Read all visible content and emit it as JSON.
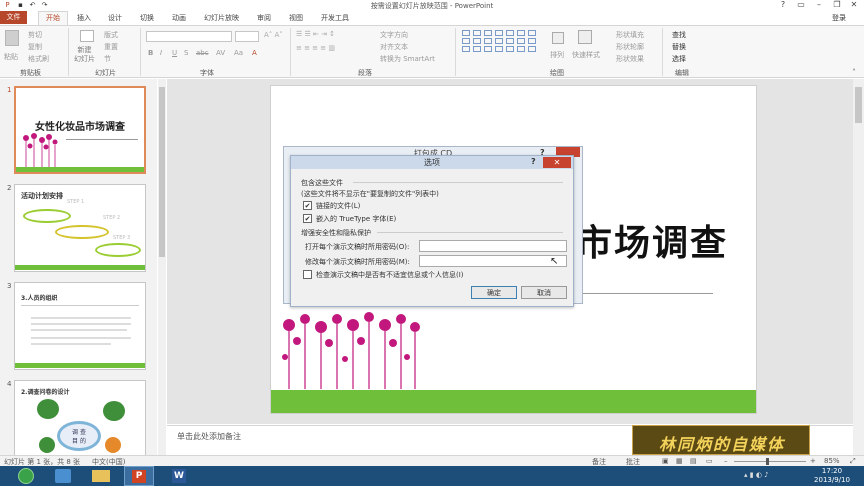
{
  "window": {
    "title": "按需设置幻灯片放映范围 - PowerPoint"
  },
  "tabs": {
    "file": "文件",
    "home": "开始",
    "insert": "插入",
    "design": "设计",
    "transitions": "切换",
    "animations": "动画",
    "slideshow": "幻灯片放映",
    "review": "审阅",
    "view": "视图",
    "developer": "开发工具",
    "login": "登录"
  },
  "ribbon": {
    "clipboard": {
      "paste": "粘贴",
      "cut": "剪切",
      "copy": "复制",
      "format_painter": "格式刷",
      "label": "剪贴板"
    },
    "slides": {
      "new_slide": "新建\n幻灯片",
      "layout": "版式",
      "reset": "重置",
      "section": "节",
      "label": "幻灯片"
    },
    "font": {
      "label": "字体",
      "bold": "B",
      "italic": "I",
      "underline": "U",
      "shadow": "S",
      "strike": "abc",
      "spacing": "AV",
      "case": "Aa",
      "color": "A"
    },
    "paragraph": {
      "text_direction": "文字方向",
      "align_text": "对齐文本",
      "smartart": "转换为 SmartArt",
      "label": "段落"
    },
    "drawing": {
      "arrange": "排列",
      "quick_styles": "快速样式",
      "fill": "形状填充",
      "outline": "形状轮廓",
      "effects": "形状效果",
      "label": "绘图"
    },
    "editing": {
      "find": "查找",
      "replace": "替换",
      "select": "选择",
      "label": "编辑"
    }
  },
  "slides": [
    {
      "num": "1",
      "title": "女性化妆品市场调查"
    },
    {
      "num": "2",
      "title": "活动计划安排",
      "items": [
        "STEP 1",
        "STEP 2",
        "STEP 3"
      ]
    },
    {
      "num": "3",
      "title": "3.人员的组织"
    },
    {
      "num": "4",
      "title": "2.调查问卷的设计",
      "center": "调 查\n目 的"
    }
  ],
  "slide_main": {
    "title": "女性化妆品市场调查",
    "visible_title": "市场调查"
  },
  "notes": {
    "placeholder": "单击此处添加备注"
  },
  "dialog_behind": {
    "title": "打包成 CD",
    "help": "?"
  },
  "dialog": {
    "title": "选项",
    "help": "?",
    "close": "✕",
    "include_section": "包含这些文件",
    "include_note": "(这些文件将不显示在\"要复制的文件\"列表中)",
    "linked_files": "链接的文件(L)",
    "linked_checked": true,
    "embed_fonts": "嵌入的 TrueType 字体(E)",
    "embed_checked": true,
    "security_section": "增强安全性和隐私保护",
    "open_pw_label": "打开每个演示文稿时所用密码(O):",
    "open_pw_value": "",
    "modify_pw_label": "修改每个演示文稿时所用密码(M):",
    "modify_pw_value": "",
    "inspect_label": "检查演示文稿中是否有不适宜信息或个人信息(I)",
    "inspect_checked": false,
    "ok": "确定",
    "cancel": "取消"
  },
  "status": {
    "slide_info": "幻灯片 第 1 张，共 8 张",
    "language": "中文(中国)",
    "notes": "备注",
    "comments": "批注",
    "zoom": "85%"
  },
  "taskbar": {
    "time": "17:20",
    "date": "2013/9/10"
  },
  "watermark": {
    "text": "林同炳的自媒体"
  },
  "colors": {
    "accent": "#b7472a",
    "slide_green": "#6fbf3a",
    "flower": "#c2187d"
  }
}
